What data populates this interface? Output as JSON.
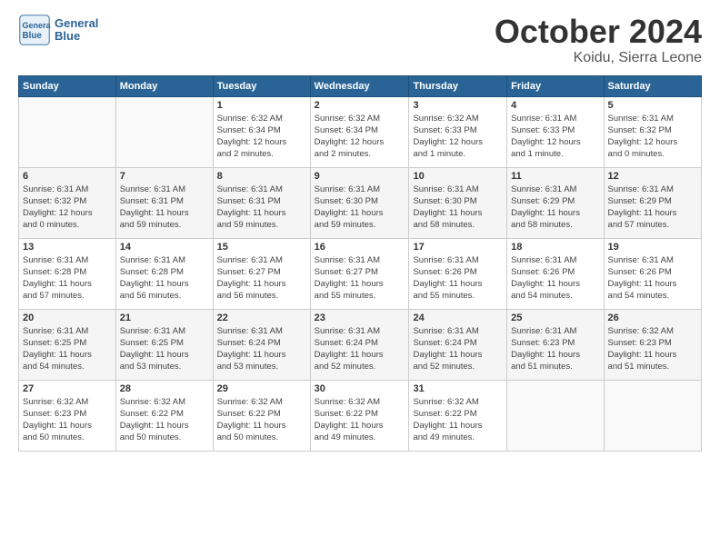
{
  "header": {
    "logo_text_general": "General",
    "logo_text_blue": "Blue",
    "month_title": "October 2024",
    "location": "Koidu, Sierra Leone"
  },
  "calendar": {
    "days_of_week": [
      "Sunday",
      "Monday",
      "Tuesday",
      "Wednesday",
      "Thursday",
      "Friday",
      "Saturday"
    ],
    "weeks": [
      [
        {
          "day": "",
          "info": ""
        },
        {
          "day": "",
          "info": ""
        },
        {
          "day": "1",
          "info": "Sunrise: 6:32 AM\nSunset: 6:34 PM\nDaylight: 12 hours\nand 2 minutes."
        },
        {
          "day": "2",
          "info": "Sunrise: 6:32 AM\nSunset: 6:34 PM\nDaylight: 12 hours\nand 2 minutes."
        },
        {
          "day": "3",
          "info": "Sunrise: 6:32 AM\nSunset: 6:33 PM\nDaylight: 12 hours\nand 1 minute."
        },
        {
          "day": "4",
          "info": "Sunrise: 6:31 AM\nSunset: 6:33 PM\nDaylight: 12 hours\nand 1 minute."
        },
        {
          "day": "5",
          "info": "Sunrise: 6:31 AM\nSunset: 6:32 PM\nDaylight: 12 hours\nand 0 minutes."
        }
      ],
      [
        {
          "day": "6",
          "info": "Sunrise: 6:31 AM\nSunset: 6:32 PM\nDaylight: 12 hours\nand 0 minutes."
        },
        {
          "day": "7",
          "info": "Sunrise: 6:31 AM\nSunset: 6:31 PM\nDaylight: 11 hours\nand 59 minutes."
        },
        {
          "day": "8",
          "info": "Sunrise: 6:31 AM\nSunset: 6:31 PM\nDaylight: 11 hours\nand 59 minutes."
        },
        {
          "day": "9",
          "info": "Sunrise: 6:31 AM\nSunset: 6:30 PM\nDaylight: 11 hours\nand 59 minutes."
        },
        {
          "day": "10",
          "info": "Sunrise: 6:31 AM\nSunset: 6:30 PM\nDaylight: 11 hours\nand 58 minutes."
        },
        {
          "day": "11",
          "info": "Sunrise: 6:31 AM\nSunset: 6:29 PM\nDaylight: 11 hours\nand 58 minutes."
        },
        {
          "day": "12",
          "info": "Sunrise: 6:31 AM\nSunset: 6:29 PM\nDaylight: 11 hours\nand 57 minutes."
        }
      ],
      [
        {
          "day": "13",
          "info": "Sunrise: 6:31 AM\nSunset: 6:28 PM\nDaylight: 11 hours\nand 57 minutes."
        },
        {
          "day": "14",
          "info": "Sunrise: 6:31 AM\nSunset: 6:28 PM\nDaylight: 11 hours\nand 56 minutes."
        },
        {
          "day": "15",
          "info": "Sunrise: 6:31 AM\nSunset: 6:27 PM\nDaylight: 11 hours\nand 56 minutes."
        },
        {
          "day": "16",
          "info": "Sunrise: 6:31 AM\nSunset: 6:27 PM\nDaylight: 11 hours\nand 55 minutes."
        },
        {
          "day": "17",
          "info": "Sunrise: 6:31 AM\nSunset: 6:26 PM\nDaylight: 11 hours\nand 55 minutes."
        },
        {
          "day": "18",
          "info": "Sunrise: 6:31 AM\nSunset: 6:26 PM\nDaylight: 11 hours\nand 54 minutes."
        },
        {
          "day": "19",
          "info": "Sunrise: 6:31 AM\nSunset: 6:26 PM\nDaylight: 11 hours\nand 54 minutes."
        }
      ],
      [
        {
          "day": "20",
          "info": "Sunrise: 6:31 AM\nSunset: 6:25 PM\nDaylight: 11 hours\nand 54 minutes."
        },
        {
          "day": "21",
          "info": "Sunrise: 6:31 AM\nSunset: 6:25 PM\nDaylight: 11 hours\nand 53 minutes."
        },
        {
          "day": "22",
          "info": "Sunrise: 6:31 AM\nSunset: 6:24 PM\nDaylight: 11 hours\nand 53 minutes."
        },
        {
          "day": "23",
          "info": "Sunrise: 6:31 AM\nSunset: 6:24 PM\nDaylight: 11 hours\nand 52 minutes."
        },
        {
          "day": "24",
          "info": "Sunrise: 6:31 AM\nSunset: 6:24 PM\nDaylight: 11 hours\nand 52 minutes."
        },
        {
          "day": "25",
          "info": "Sunrise: 6:31 AM\nSunset: 6:23 PM\nDaylight: 11 hours\nand 51 minutes."
        },
        {
          "day": "26",
          "info": "Sunrise: 6:32 AM\nSunset: 6:23 PM\nDaylight: 11 hours\nand 51 minutes."
        }
      ],
      [
        {
          "day": "27",
          "info": "Sunrise: 6:32 AM\nSunset: 6:23 PM\nDaylight: 11 hours\nand 50 minutes."
        },
        {
          "day": "28",
          "info": "Sunrise: 6:32 AM\nSunset: 6:22 PM\nDaylight: 11 hours\nand 50 minutes."
        },
        {
          "day": "29",
          "info": "Sunrise: 6:32 AM\nSunset: 6:22 PM\nDaylight: 11 hours\nand 50 minutes."
        },
        {
          "day": "30",
          "info": "Sunrise: 6:32 AM\nSunset: 6:22 PM\nDaylight: 11 hours\nand 49 minutes."
        },
        {
          "day": "31",
          "info": "Sunrise: 6:32 AM\nSunset: 6:22 PM\nDaylight: 11 hours\nand 49 minutes."
        },
        {
          "day": "",
          "info": ""
        },
        {
          "day": "",
          "info": ""
        }
      ]
    ]
  }
}
